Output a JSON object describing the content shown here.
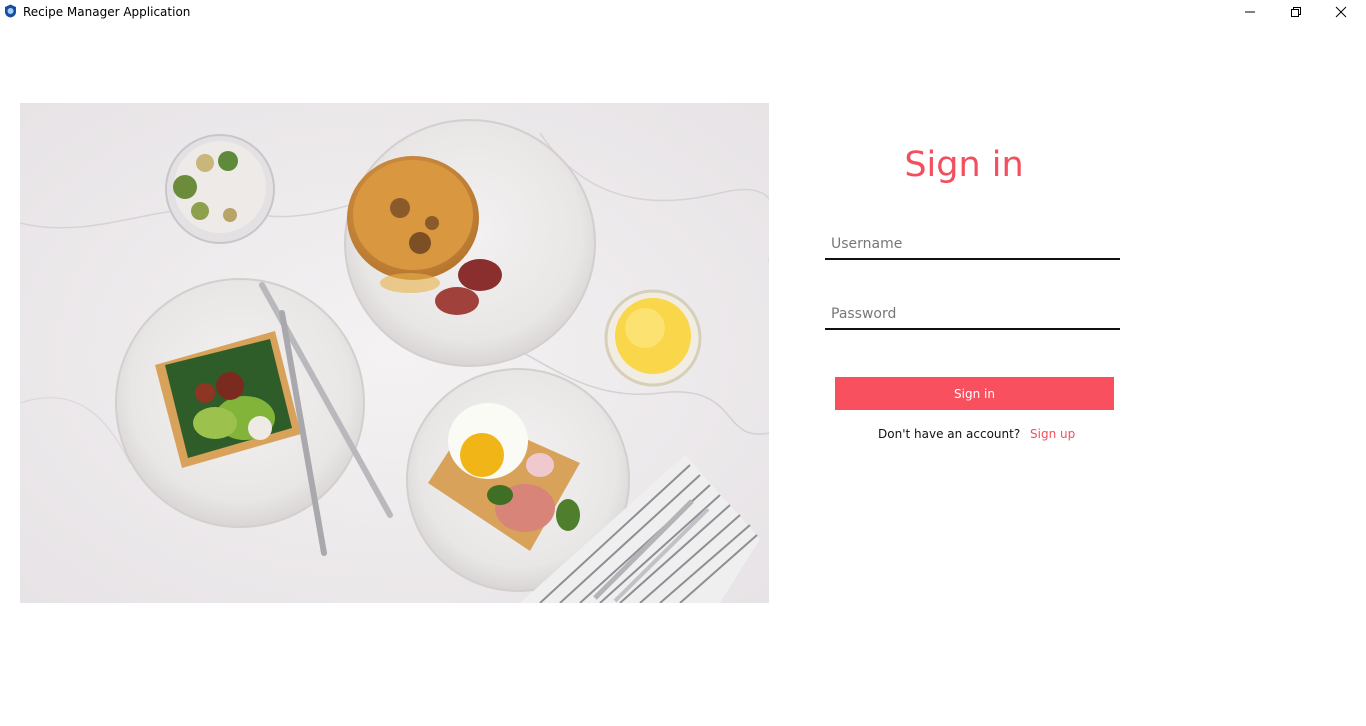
{
  "window": {
    "title": "Recipe Manager Application",
    "icons": [
      "app-icon",
      "minimize-icon",
      "restore-icon",
      "close-icon"
    ]
  },
  "login": {
    "heading": "Sign in",
    "username_placeholder": "Username",
    "password_placeholder": "Password",
    "submit_label": "Sign in",
    "signup_prompt": "Don't have an account?",
    "signup_link": "Sign up"
  },
  "colors": {
    "accent": "#f8505f",
    "heading": "#f2505f",
    "underline": "#111111"
  }
}
